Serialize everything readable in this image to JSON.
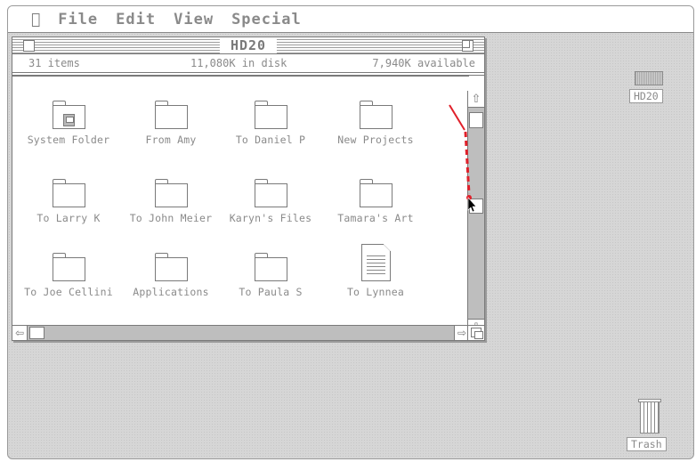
{
  "menubar": {
    "apple_glyph": "🍎",
    "menus": [
      "File",
      "Edit",
      "View",
      "Special"
    ]
  },
  "window": {
    "title": "HD20",
    "info": {
      "items": "31 items",
      "in_disk": "11,080K in disk",
      "available": "7,940K available"
    },
    "icons": [
      {
        "label": "System Folder",
        "kind": "system-folder"
      },
      {
        "label": "From Amy",
        "kind": "folder"
      },
      {
        "label": "To Daniel P",
        "kind": "folder"
      },
      {
        "label": "New Projects",
        "kind": "folder"
      },
      {
        "label": "To Larry K",
        "kind": "folder"
      },
      {
        "label": "To John Meier",
        "kind": "folder"
      },
      {
        "label": "Karyn's Files",
        "kind": "folder"
      },
      {
        "label": "Tamara's Art",
        "kind": "folder"
      },
      {
        "label": "To Joe Cellini",
        "kind": "folder"
      },
      {
        "label": "Applications",
        "kind": "folder"
      },
      {
        "label": "To Paula S",
        "kind": "folder"
      },
      {
        "label": "To Lynnea",
        "kind": "document"
      }
    ]
  },
  "desktop": {
    "disk_label": "HD20",
    "trash_label": "Trash"
  },
  "colors": {
    "annotation_red": "#e0202a",
    "chrome_gray": "#7a7a7a",
    "desktop_gray": "#d6d6d6"
  }
}
